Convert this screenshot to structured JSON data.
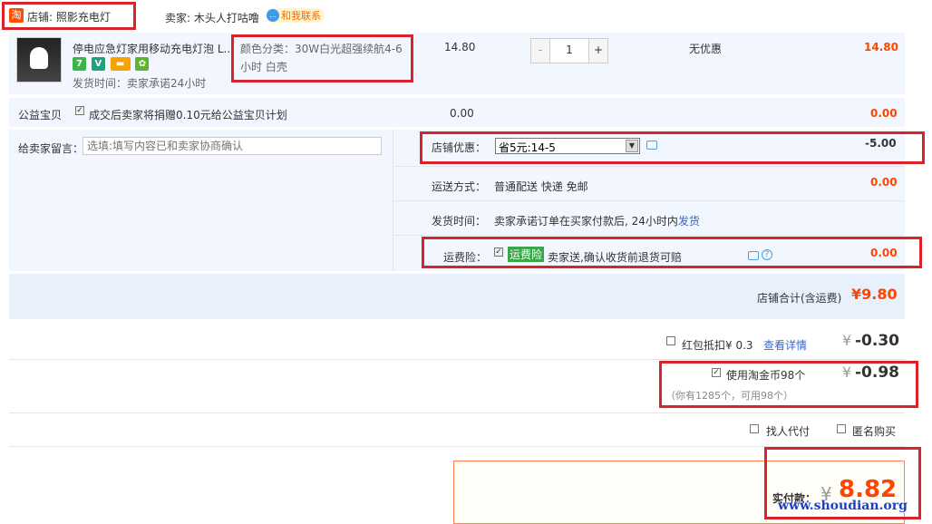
{
  "shop": {
    "logo_char": "淘",
    "name_label": "店铺: 照影充电灯",
    "seller_label": "卖家: 木头人打咕噜",
    "contact_label": "和我联系",
    "contact_icon": "chat-bubble-icon"
  },
  "item": {
    "title": "停电应急灯家用移动充电灯泡 L...",
    "color_line1": "颜色分类：30W白光超强续航4-6",
    "color_line2": "小时 白壳",
    "ship_time": "发货时间：卖家承诺24小时",
    "price": "14.80",
    "quantity": "1",
    "minus": "-",
    "plus": "+",
    "promo": "无优惠",
    "subtotal": "14.80",
    "badges": [
      "7",
      "V",
      "▬",
      "✿"
    ]
  },
  "charity": {
    "label": "公益宝贝",
    "text": "成交后卖家将捐赠0.10元给公益宝贝计划",
    "price": "0.00",
    "subtotal": "0.00"
  },
  "message": {
    "label": "给卖家留言：",
    "placeholder": "选填:填写内容已和卖家协商确认"
  },
  "shop_discount": {
    "label": "店铺优惠：",
    "selected": "省5元:14-5",
    "amount": "-5.00"
  },
  "shipping": {
    "label": "运送方式：",
    "value": "普通配送 快递 免邮",
    "amount": "0.00"
  },
  "delivery": {
    "label": "发货时间：",
    "value": "卖家承诺订单在买家付款后, 24小时内",
    "link": "发货"
  },
  "insurance": {
    "label": "运费险：",
    "tag": "运费险",
    "text": "卖家送,确认收货前退货可赔",
    "amount": "0.00"
  },
  "shop_total": {
    "label": "店铺合计(含运费)",
    "amount": "¥9.80"
  },
  "redpacket": {
    "label": "红包抵扣¥ 0.3",
    "link": "查看详情",
    "currency": "¥",
    "amount": "-0.30"
  },
  "taojinbi": {
    "label": "使用淘金币98个",
    "currency": "¥",
    "amount": "-0.98",
    "note": "（你有1285个，可用98个）"
  },
  "options": {
    "proxy_pay": "找人代付",
    "anonymous": "匿名购买"
  },
  "payment": {
    "label": "实付款：",
    "currency": "¥",
    "amount": "8.82"
  },
  "watermark": "www.shoudian.org"
}
